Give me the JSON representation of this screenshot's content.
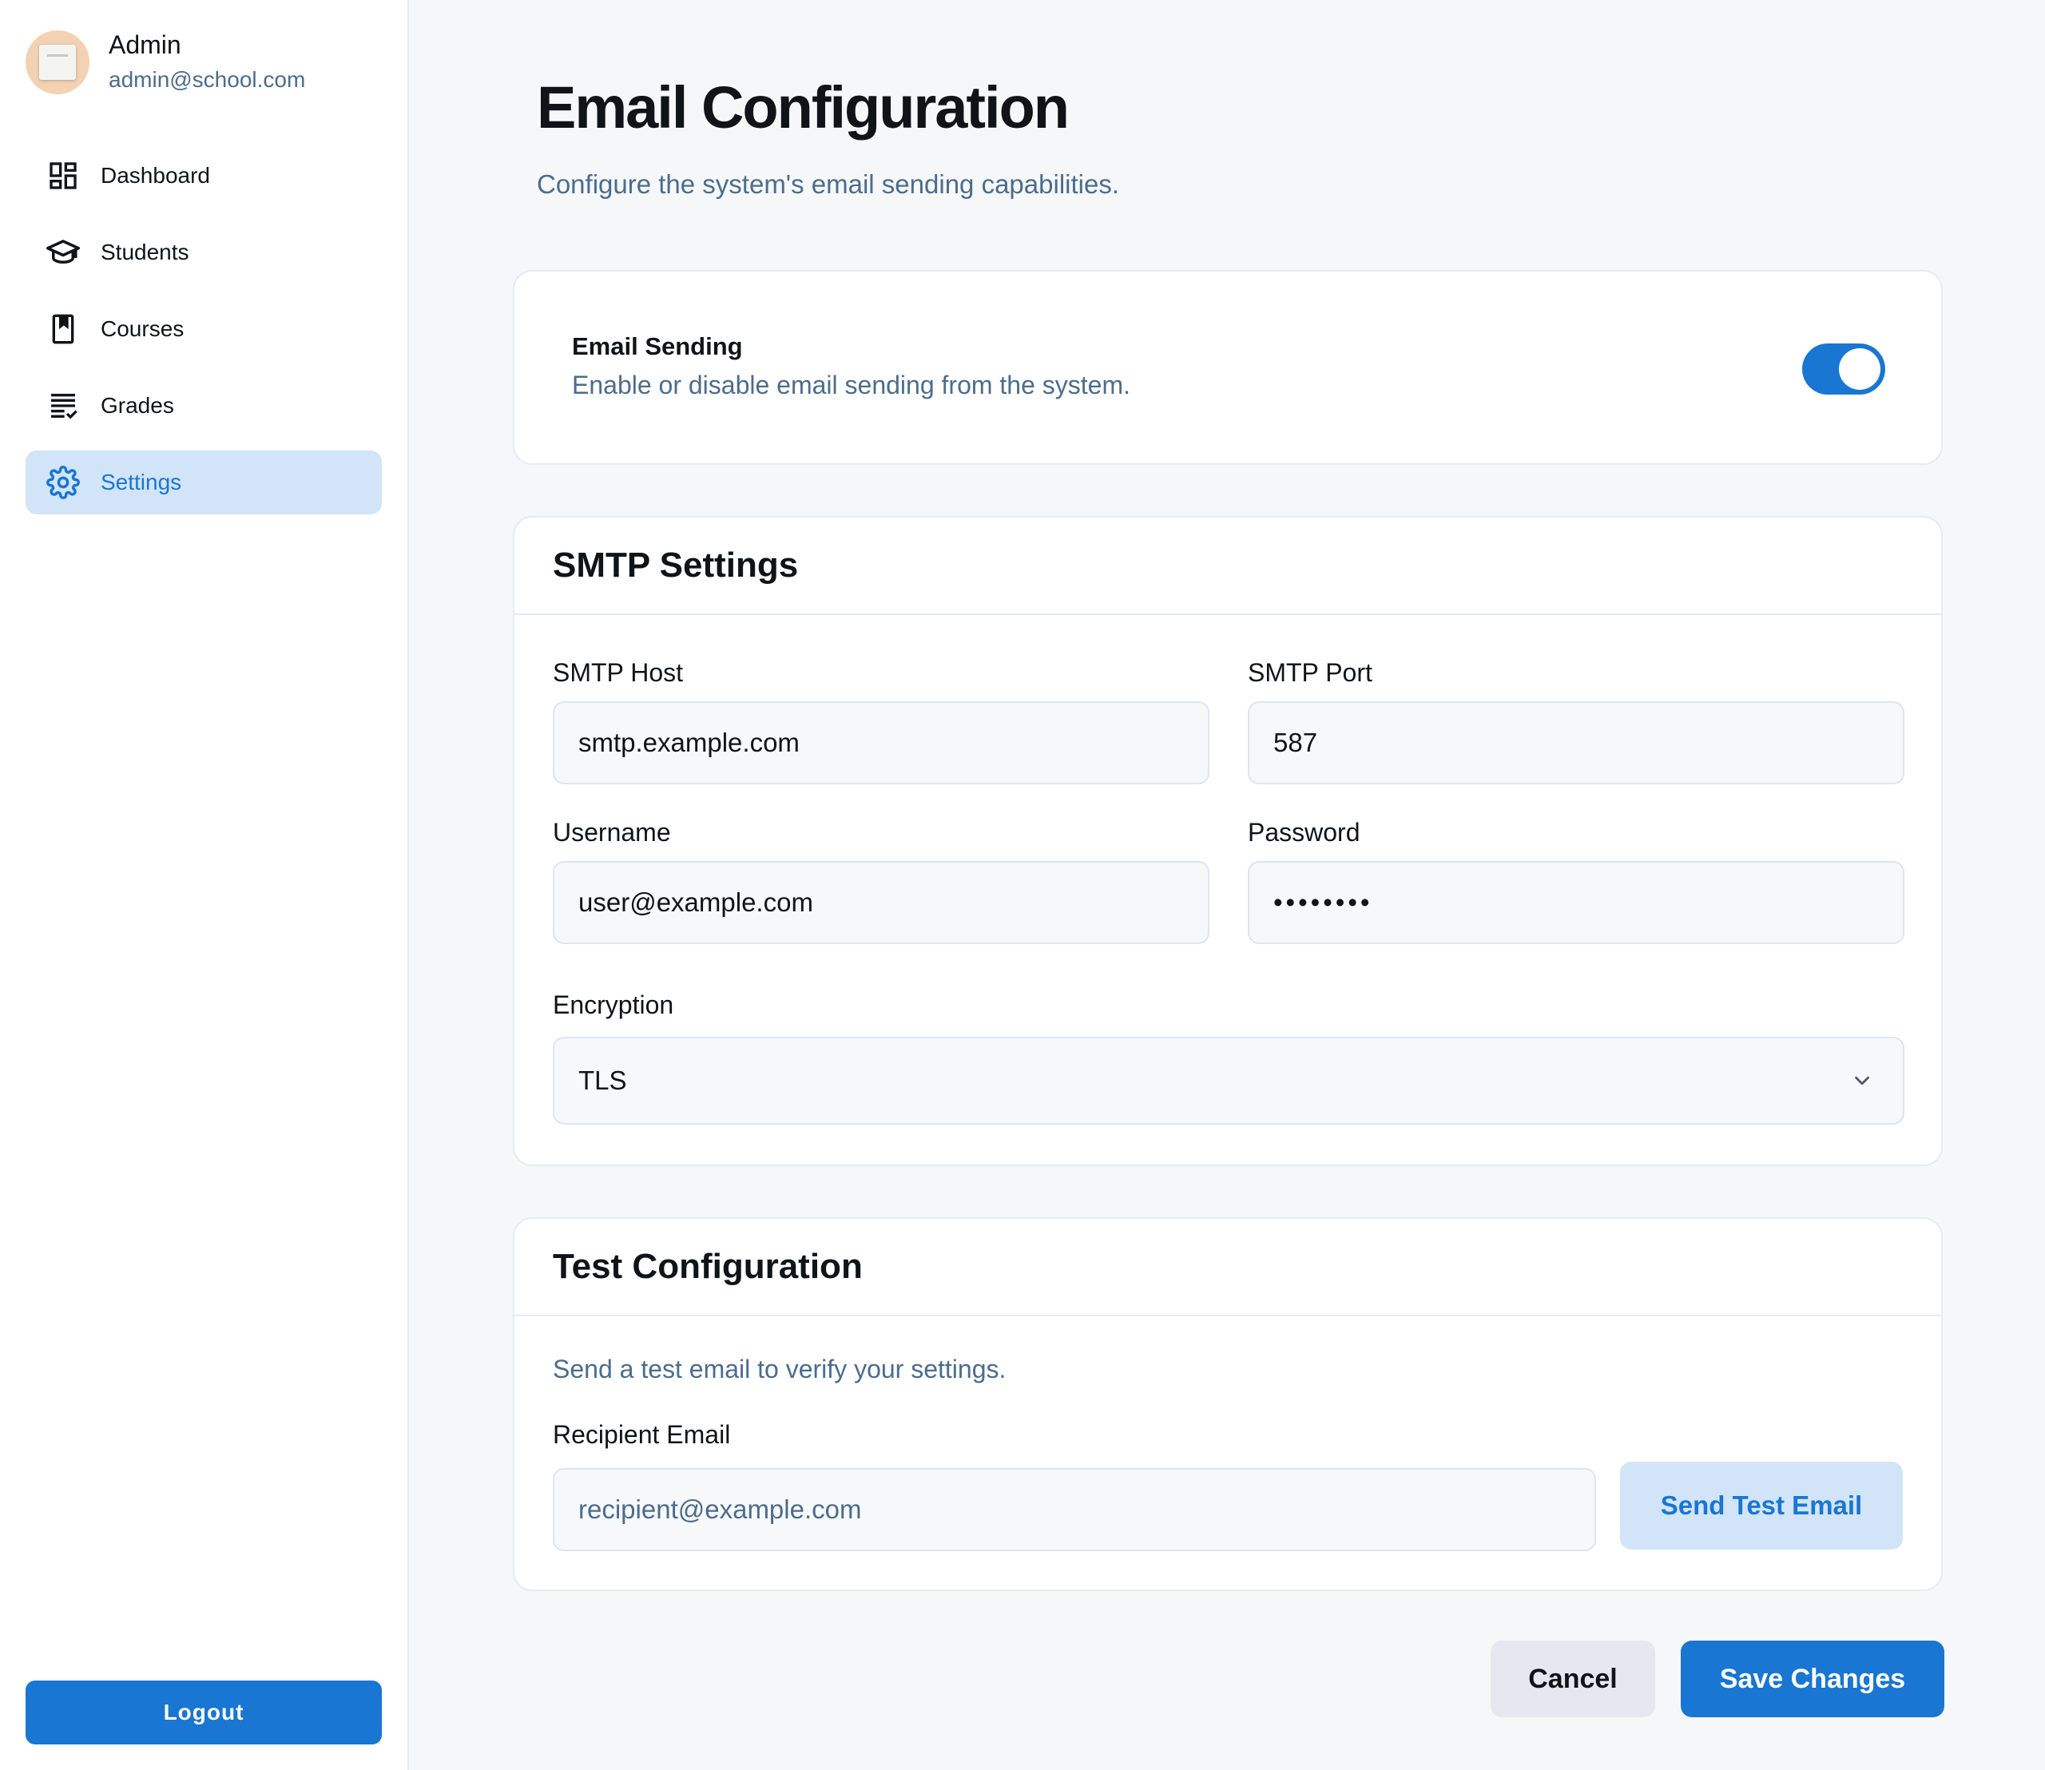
{
  "user": {
    "name": "Admin",
    "email": "admin@school.com"
  },
  "sidebar": {
    "items": [
      {
        "label": "Dashboard",
        "icon": "dashboard-icon",
        "active": false
      },
      {
        "label": "Students",
        "icon": "graduation-cap-icon",
        "active": false
      },
      {
        "label": "Courses",
        "icon": "book-icon",
        "active": false
      },
      {
        "label": "Grades",
        "icon": "checklist-icon",
        "active": false
      },
      {
        "label": "Settings",
        "icon": "gear-icon",
        "active": true
      }
    ],
    "logout_label": "Logout"
  },
  "page": {
    "title": "Email Configuration",
    "subtitle": "Configure the system's email sending capabilities."
  },
  "email_sending": {
    "title": "Email Sending",
    "description": "Enable or disable email sending from the system.",
    "enabled": true
  },
  "smtp": {
    "title": "SMTP Settings",
    "host_label": "SMTP Host",
    "host_value": "smtp.example.com",
    "port_label": "SMTP Port",
    "port_value": "587",
    "username_label": "Username",
    "username_value": "user@example.com",
    "password_label": "Password",
    "password_value": "••••••••",
    "encryption_label": "Encryption",
    "encryption_value": "TLS"
  },
  "test": {
    "title": "Test Configuration",
    "description": "Send a test email to verify your settings.",
    "recipient_label": "Recipient Email",
    "recipient_placeholder": "recipient@example.com",
    "send_label": "Send Test Email"
  },
  "actions": {
    "cancel_label": "Cancel",
    "save_label": "Save Changes"
  },
  "colors": {
    "accent": "#1976d2",
    "accent_light": "#d2e4f7",
    "muted_text": "#4c6c8c",
    "background": "#f6f7f9"
  }
}
